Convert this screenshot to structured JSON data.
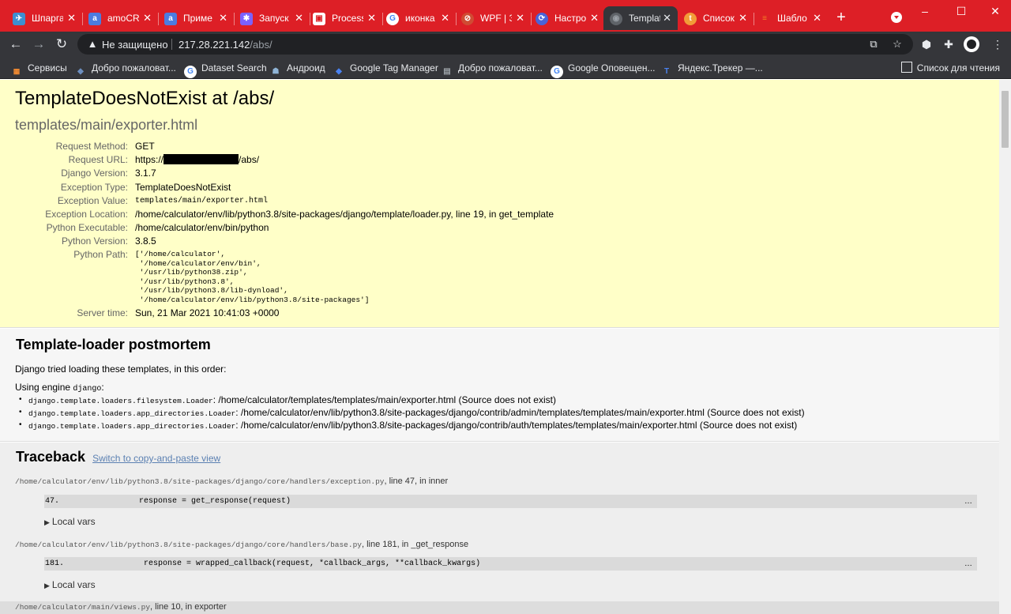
{
  "browser": {
    "tabs": [
      {
        "label": "Шпарга",
        "icon": "telegram-icon",
        "color": "#3d8fd1",
        "glyph": "✈"
      },
      {
        "label": "amoCR",
        "icon": "amocrm-icon",
        "color": "#4c7ce0",
        "glyph": "a"
      },
      {
        "label": "Приме",
        "icon": "amocrm-icon",
        "color": "#4c7ce0",
        "glyph": "a"
      },
      {
        "label": "Запуск",
        "icon": "puzzle-icon",
        "color": "#7b61ff",
        "glyph": "✱"
      },
      {
        "label": "Process",
        "icon": "document-icon",
        "color": "#ffffff",
        "glyph": "▣"
      },
      {
        "label": "иконка",
        "icon": "google-icon",
        "color": "#ffffff",
        "glyph": "G"
      },
      {
        "label": "WPF | З",
        "icon": "disabled-icon",
        "color": "#d04b33",
        "glyph": "⊘"
      },
      {
        "label": "Настро",
        "icon": "sync-icon",
        "color": "#4a63d8",
        "glyph": "⟳"
      },
      {
        "label": "Templat",
        "icon": "globe-icon",
        "color": "#9aa0a6",
        "glyph": "◉",
        "active": true
      },
      {
        "label": "Список",
        "icon": "list-site-icon",
        "color": "#f29c38",
        "glyph": "t"
      },
      {
        "label": "Шабло",
        "icon": "stackoverflow-icon",
        "color": "#f48024",
        "glyph": "≡"
      }
    ],
    "window_controls": {
      "minimize": "–",
      "maximize": "☐",
      "close": "✕"
    },
    "new_tab": "+",
    "nav": {
      "back": "←",
      "forward": "→",
      "reload": "↻"
    },
    "address": {
      "security_label": "Не защищено",
      "host": "217.28.221.142",
      "path": "/abs/"
    },
    "bookmarks": [
      {
        "label": "Сервисы",
        "icon": "apps-grid-icon",
        "color": "#e8eaed",
        "glyph": "⋮⋮"
      },
      {
        "label": "Добро пожаловат...",
        "icon": "bookmark-site-icon",
        "color": "#6c8ebf",
        "glyph": "◆"
      },
      {
        "label": "Dataset Search",
        "icon": "google-icon",
        "color": "#ffffff",
        "glyph": "G"
      },
      {
        "label": "Андроид",
        "icon": "android-icon",
        "color": "#8fb4d6",
        "glyph": "☗"
      },
      {
        "label": "Google Tag Manager",
        "icon": "tag-manager-icon",
        "color": "#4a82f0",
        "glyph": "◆"
      },
      {
        "label": "Добро пожаловат...",
        "icon": "bookmark-site-icon",
        "color": "#9aa0a6",
        "glyph": "▤"
      },
      {
        "label": "Google Оповещен...",
        "icon": "google-icon",
        "color": "#ffffff",
        "glyph": "G"
      },
      {
        "label": "Яндекс.Трекер —...",
        "icon": "yandex-tracker-icon",
        "color": "#4a82f0",
        "glyph": "T"
      }
    ],
    "reading_list": "Список для чтения"
  },
  "error": {
    "title": "TemplateDoesNotExist at /abs/",
    "subtitle": "templates/main/exporter.html",
    "meta": [
      {
        "key": "Request Method:",
        "value": "GET"
      },
      {
        "key": "Request URL:",
        "value_prefix": "https://",
        "value_suffix": "/abs/"
      },
      {
        "key": "Django Version:",
        "value": "3.1.7"
      },
      {
        "key": "Exception Type:",
        "value": "TemplateDoesNotExist"
      },
      {
        "key": "Exception Value:",
        "value": "templates/main/exporter.html"
      },
      {
        "key": "Exception Location:",
        "value": "/home/calculator/env/lib/python3.8/site-packages/django/template/loader.py, line 19, in get_template"
      },
      {
        "key": "Python Executable:",
        "value": "/home/calculator/env/bin/python"
      },
      {
        "key": "Python Version:",
        "value": "3.8.5"
      },
      {
        "key": "Python Path:",
        "value": "['/home/calculator',\n '/home/calculator/env/bin',\n '/usr/lib/python38.zip',\n '/usr/lib/python3.8',\n '/usr/lib/python3.8/lib-dynload',\n '/home/calculator/env/lib/python3.8/site-packages']"
      },
      {
        "key": "Server time:",
        "value": "Sun, 21 Mar 2021 10:41:03 +0000"
      }
    ]
  },
  "postmortem": {
    "title": "Template-loader postmortem",
    "intro": "Django tried loading these templates, in this order:",
    "engine_prefix": "Using engine",
    "engine_name": "django",
    "engine_suffix": ":",
    "items": [
      {
        "loader": "django.template.loaders.filesystem.Loader",
        "path": ": /home/calculator/templates/templates/main/exporter.html (Source does not exist)"
      },
      {
        "loader": "django.template.loaders.app_directories.Loader",
        "path": ": /home/calculator/env/lib/python3.8/site-packages/django/contrib/admin/templates/templates/main/exporter.html (Source does not exist)"
      },
      {
        "loader": "django.template.loaders.app_directories.Loader",
        "path": ": /home/calculator/env/lib/python3.8/site-packages/django/contrib/auth/templates/templates/main/exporter.html (Source does not exist)"
      }
    ]
  },
  "traceback": {
    "title": "Traceback",
    "switch_link": "Switch to copy-and-paste view",
    "local_vars": "Local vars",
    "frames": [
      {
        "file": "/home/calculator/env/lib/python3.8/site-packages/django/core/handlers/exception.py",
        "where": ", line 47, in inner",
        "line_no": "47.",
        "code": "response = get_response(request)",
        "ellipsis": "…"
      },
      {
        "file": "/home/calculator/env/lib/python3.8/site-packages/django/core/handlers/base.py",
        "where": ", line 181, in _get_response",
        "line_no": "181.",
        "code": "response = wrapped_callback(request, *callback_args, **callback_kwargs)",
        "ellipsis": "…"
      },
      {
        "file": "/home/calculator/main/views.py",
        "where": ", line 10, in exporter"
      }
    ]
  }
}
